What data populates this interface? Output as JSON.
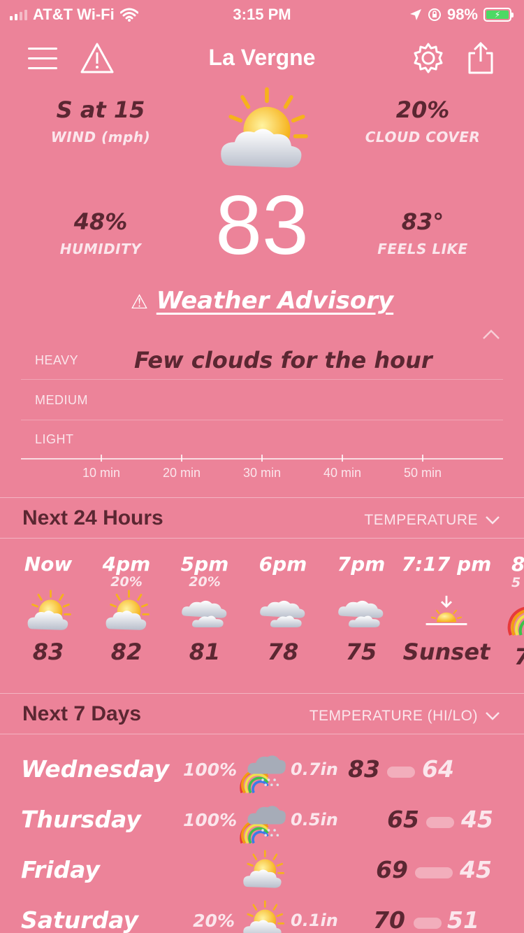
{
  "status_bar": {
    "carrier": "AT&T Wi-Fi",
    "time": "3:15 PM",
    "battery": "98%"
  },
  "header": {
    "title": "La Vergne"
  },
  "current": {
    "wind_value": "S at 15",
    "wind_label": "WIND (mph)",
    "cloud_value": "20%",
    "cloud_label": "CLOUD COVER",
    "humidity_value": "48%",
    "humidity_label": "HUMIDITY",
    "feels_value": "83°",
    "feels_label": "FEELS LIKE",
    "temperature": "83",
    "advisory": "Weather Advisory"
  },
  "precip": {
    "summary": "Few clouds for the hour",
    "levels": [
      "HEAVY",
      "MEDIUM",
      "LIGHT"
    ],
    "ticks": [
      "10 min",
      "20 min",
      "30 min",
      "40 min",
      "50 min"
    ]
  },
  "hourly": {
    "title": "Next 24 Hours",
    "selector": "TEMPERATURE",
    "items": [
      {
        "time": "Now",
        "precip": "",
        "icon": "sun-cloud-icon",
        "value": "83"
      },
      {
        "time": "4pm",
        "precip": "20%",
        "icon": "sun-cloud-icon",
        "value": "82"
      },
      {
        "time": "5pm",
        "precip": "20%",
        "icon": "clouds-icon",
        "value": "81"
      },
      {
        "time": "6pm",
        "precip": "",
        "icon": "clouds-icon",
        "value": "78"
      },
      {
        "time": "7pm",
        "precip": "",
        "icon": "clouds-icon",
        "value": "75"
      },
      {
        "time": "7:17 pm",
        "precip": "",
        "icon": "sunset-icon",
        "value": "Sunset"
      },
      {
        "time": "8",
        "precip": "5",
        "icon": "rainbow-icon",
        "value": "7"
      }
    ]
  },
  "daily": {
    "title": "Next 7 Days",
    "selector": "TEMPERATURE (HI/LO)",
    "items": [
      {
        "day": "Wednesday",
        "precip": "100%",
        "icon": "rainbow-storm-icon",
        "amount": "0.7in",
        "hi": "83",
        "lo": "64"
      },
      {
        "day": "Thursday",
        "precip": "100%",
        "icon": "rainbow-storm-icon",
        "amount": "0.5in",
        "hi": "65",
        "lo": "45"
      },
      {
        "day": "Friday",
        "precip": "",
        "icon": "sun-cloud-icon",
        "amount": "",
        "hi": "69",
        "lo": "45"
      },
      {
        "day": "Saturday",
        "precip": "20%",
        "icon": "sun-cloud-icon",
        "amount": "0.1in",
        "hi": "70",
        "lo": "51"
      }
    ]
  },
  "colors": {
    "background": "#ec8399",
    "dark_text": "#5b2732",
    "battery_green": "#4cd964"
  }
}
